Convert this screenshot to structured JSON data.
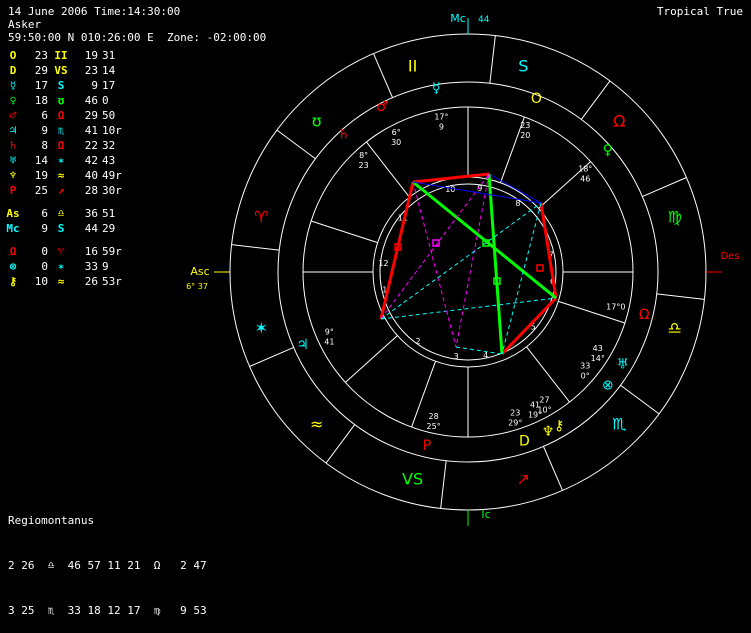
{
  "header": {
    "date_time": "14 June 2006 Time:14:30:00",
    "chart_name": "Asker",
    "location": "59:50:00 N 010:26:00 E  Zone: -02:00:00",
    "zodiac": "Tropical True"
  },
  "planets": [
    {
      "glyph": "O",
      "color": "#ffff00",
      "deg": "23",
      "sign": "II",
      "sign_color": "#ffff00",
      "min": "19",
      "sec": "31"
    },
    {
      "glyph": "D",
      "color": "#ffff00",
      "deg": "29",
      "sign": "VS",
      "sign_color": "#ffff00",
      "min": "23",
      "sec": "14"
    },
    {
      "glyph": "☿",
      "color": "#00ffff",
      "deg": "17",
      "sign": "S",
      "sign_color": "#00ffff",
      "min": "9",
      "sec": "17"
    },
    {
      "glyph": "♀",
      "color": "#00ff00",
      "deg": "18",
      "sign": "ʊ",
      "sign_color": "#00ff00",
      "min": "46",
      "sec": "0"
    },
    {
      "glyph": "♂",
      "color": "#ff0000",
      "deg": "6",
      "sign": "Ω",
      "sign_color": "#ff0000",
      "min": "29",
      "sec": "50"
    },
    {
      "glyph": "♃",
      "color": "#00ffff",
      "deg": "9",
      "sign": "♏",
      "sign_color": "#00ffff",
      "min": "41",
      "sec": "10r"
    },
    {
      "glyph": "♄",
      "color": "#ff0000",
      "deg": "8",
      "sign": "Ω",
      "sign_color": "#ff0000",
      "min": "22",
      "sec": "32"
    },
    {
      "glyph": "♅",
      "color": "#00ffff",
      "deg": "14",
      "sign": "✶",
      "sign_color": "#00ffff",
      "min": "42",
      "sec": "43"
    },
    {
      "glyph": "♆",
      "color": "#ffff00",
      "deg": "19",
      "sign": "≈",
      "sign_color": "#ffff00",
      "min": "40",
      "sec": "49r"
    },
    {
      "glyph": "P",
      "color": "#ff0000",
      "deg": "25",
      "sign": "↗",
      "sign_color": "#ff0000",
      "min": "28",
      "sec": "30r"
    }
  ],
  "angles": [
    {
      "glyph": "As",
      "color": "#ffff00",
      "deg": "6",
      "sign": "♎",
      "sign_color": "#ffff00",
      "min": "36",
      "sec": "51"
    },
    {
      "glyph": "Mc",
      "color": "#00ffff",
      "deg": "9",
      "sign": "S",
      "sign_color": "#00ffff",
      "min": "44",
      "sec": "29"
    }
  ],
  "points": [
    {
      "glyph": "Ω",
      "color": "#ff0000",
      "deg": "0",
      "sign": "♈",
      "sign_color": "#ff0000",
      "min": "16",
      "sec": "59r"
    },
    {
      "glyph": "⊗",
      "color": "#00ffff",
      "deg": "0",
      "sign": "✶",
      "sign_color": "#00ffff",
      "min": "33",
      "sec": "9"
    },
    {
      "glyph": "⚷",
      "color": "#ffff00",
      "deg": "10",
      "sign": "≈",
      "sign_color": "#ffff00",
      "min": "26",
      "sec": "53r"
    }
  ],
  "house_system": "Regiomontanus",
  "house_rows": [
    "2 26  ♎  46 57 11 21  Ω   2 47",
    "3 25  ♏  33 18 12 17  ♍   9 53"
  ],
  "wheel": {
    "mc_label": "Mc",
    "mc_value": "44",
    "ic_label": "Ic",
    "asc_label": "Asc",
    "asc_value": "6° 37",
    "des_label": "Des",
    "house_numbers": [
      "1",
      "2",
      "3",
      "4",
      "5",
      "6",
      "7",
      "8",
      "9",
      "10",
      "11",
      "12"
    ],
    "signs": [
      {
        "glyph": "S",
        "color": "#00ffff",
        "name": "cancer-icon"
      },
      {
        "glyph": "II",
        "color": "#ffff00",
        "name": "gemini-icon"
      },
      {
        "glyph": "ʊ",
        "color": "#00ff00",
        "name": "taurus-icon"
      },
      {
        "glyph": "♈",
        "color": "#ff0000",
        "name": "aries-icon"
      },
      {
        "glyph": "✶",
        "color": "#00ffff",
        "name": "pisces-icon"
      },
      {
        "glyph": "≈",
        "color": "#ffff00",
        "name": "aquarius-icon"
      },
      {
        "glyph": "VS",
        "color": "#00ff00",
        "name": "capricorn-icon"
      },
      {
        "glyph": "↗",
        "color": "#ff0000",
        "name": "sagittarius-icon"
      },
      {
        "glyph": "♏",
        "color": "#00ffff",
        "name": "scorpio-icon"
      },
      {
        "glyph": "♎",
        "color": "#ffff00",
        "name": "libra-icon"
      },
      {
        "glyph": "♍",
        "color": "#00ff00",
        "name": "virgo-icon"
      },
      {
        "glyph": "Ω",
        "color": "#ff0000",
        "name": "leo-icon"
      }
    ],
    "planet_labels": [
      {
        "name": "mercury",
        "glyph": "☿",
        "color": "#00ffff",
        "top": "17°",
        "bottom": "9"
      },
      {
        "name": "sun",
        "glyph": "O",
        "color": "#ffff00",
        "top": "23",
        "bottom": "20"
      },
      {
        "name": "mars",
        "glyph": "♂",
        "color": "#ff0000",
        "top": "6°",
        "bottom": "30"
      },
      {
        "name": "saturn",
        "glyph": "♄",
        "color": "#ff0000",
        "top": "8°",
        "bottom": "23"
      },
      {
        "name": "venus",
        "glyph": "♀",
        "color": "#00ff00",
        "top": "18°",
        "bottom": "46"
      },
      {
        "name": "node",
        "glyph": "Ω",
        "color": "#ff0000",
        "top": "17°0",
        "bottom": ""
      },
      {
        "name": "uranus",
        "glyph": "♅",
        "color": "#00ffff",
        "top": "43",
        "bottom": "14°"
      },
      {
        "name": "fortune",
        "glyph": "⊗",
        "color": "#00ffff",
        "top": "33",
        "bottom": "0°"
      },
      {
        "name": "chiron",
        "glyph": "⚷",
        "color": "#ffff00",
        "top": "27",
        "bottom": "10°"
      },
      {
        "name": "neptune",
        "glyph": "♆",
        "color": "#ffff00",
        "top": "41",
        "bottom": "19°"
      },
      {
        "name": "moon",
        "glyph": "D",
        "color": "#ffff00",
        "top": "23",
        "bottom": "29°"
      },
      {
        "name": "pluto",
        "glyph": "P",
        "color": "#ff0000",
        "top": "28",
        "bottom": "25°"
      },
      {
        "name": "jupiter",
        "glyph": "♃",
        "color": "#00ffff",
        "top": "9°",
        "bottom": "41"
      }
    ],
    "colors": {
      "red": "#ff0000",
      "green": "#00ff00",
      "blue": "#0000ff",
      "cyan": "#00ffff",
      "magenta": "#ff00ff",
      "yellow": "#ffff00",
      "white": "#ffffff"
    }
  }
}
